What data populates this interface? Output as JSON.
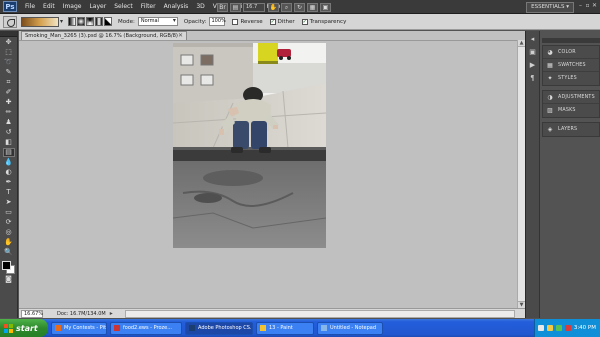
{
  "app": {
    "logo": "Ps",
    "menu": [
      "File",
      "Edit",
      "Image",
      "Layer",
      "Select",
      "Filter",
      "Analysis",
      "3D",
      "View",
      "Window",
      "Help"
    ],
    "zoom_value": "16.7",
    "workspace": "ESSENTIALS",
    "workspace_arrow": "▾",
    "window_controls": [
      "–",
      "▫",
      "✕"
    ]
  },
  "options": {
    "mode_label": "Mode:",
    "mode_value": "Normal",
    "opacity_label": "Opacity:",
    "opacity_value": "100%",
    "reverse_label": "Reverse",
    "reverse_checked": false,
    "dither_label": "Dither",
    "dither_checked": true,
    "transparency_label": "Transparency",
    "transparency_checked": true,
    "check_mark": "✓"
  },
  "document": {
    "tab_title": "Smoking_Man_3265 (3).psd @ 16.7% (Background, RGB/8)",
    "tab_close": "✕",
    "zoom_field": "16.67%",
    "doc_info": "Doc: 16.7M/134.0M",
    "status_arrow": "▸"
  },
  "tools": [
    {
      "name": "move-tool-icon",
      "glyph": "✥"
    },
    {
      "name": "marquee-tool-icon",
      "glyph": "⬚"
    },
    {
      "name": "lasso-tool-icon",
      "glyph": "➰"
    },
    {
      "name": "quick-select-tool-icon",
      "glyph": "✎"
    },
    {
      "name": "crop-tool-icon",
      "glyph": "⌗"
    },
    {
      "name": "eyedropper-tool-icon",
      "glyph": "✐"
    },
    {
      "name": "healing-brush-tool-icon",
      "glyph": "✚"
    },
    {
      "name": "brush-tool-icon",
      "glyph": "✏"
    },
    {
      "name": "clone-stamp-tool-icon",
      "glyph": "♟"
    },
    {
      "name": "history-brush-tool-icon",
      "glyph": "↺"
    },
    {
      "name": "eraser-tool-icon",
      "glyph": "◧"
    },
    {
      "name": "gradient-tool-icon",
      "glyph": "▤",
      "active": true
    },
    {
      "name": "blur-tool-icon",
      "glyph": "💧"
    },
    {
      "name": "dodge-tool-icon",
      "glyph": "◐"
    },
    {
      "name": "pen-tool-icon",
      "glyph": "✒"
    },
    {
      "name": "type-tool-icon",
      "glyph": "T"
    },
    {
      "name": "path-selection-tool-icon",
      "glyph": "➤"
    },
    {
      "name": "shape-tool-icon",
      "glyph": "▭"
    },
    {
      "name": "3d-rotate-tool-icon",
      "glyph": "⟳"
    },
    {
      "name": "3d-orbit-tool-icon",
      "glyph": "◎"
    },
    {
      "name": "hand-tool-icon",
      "glyph": "✋"
    },
    {
      "name": "zoom-tool-icon",
      "glyph": "🔍"
    }
  ],
  "dock": {
    "strip": [
      {
        "name": "dock-collapse-icon",
        "glyph": "◂"
      },
      {
        "name": "history-panel-icon",
        "glyph": "▣"
      },
      {
        "name": "actions-panel-icon",
        "glyph": "▶"
      },
      {
        "name": "paragraph-panel-icon",
        "glyph": "¶"
      }
    ],
    "groups": [
      [
        {
          "label": "COLOR",
          "icon": "color-panel-icon",
          "glyph": "◕"
        },
        {
          "label": "SWATCHES",
          "icon": "swatches-panel-icon",
          "glyph": "▦"
        },
        {
          "label": "STYLES",
          "icon": "styles-panel-icon",
          "glyph": "✦"
        }
      ],
      [
        {
          "label": "ADJUSTMENTS",
          "icon": "adjustments-panel-icon",
          "glyph": "◑"
        },
        {
          "label": "MASKS",
          "icon": "masks-panel-icon",
          "glyph": "▨"
        }
      ],
      [
        {
          "label": "LAYERS",
          "icon": "layers-panel-icon",
          "glyph": "◈"
        }
      ]
    ]
  },
  "taskbar": {
    "start_label": "start",
    "items": [
      {
        "label": "My Contests - Pit.Ey...",
        "icon_color": "#e86b1c"
      },
      {
        "label": "food2.ews - Proze...",
        "icon_color": "#cc3333"
      },
      {
        "label": "Adobe Photoshop CS...",
        "icon_color": "#1b3e70",
        "active": true
      },
      {
        "label": "13 - Paint",
        "icon_color": "#f2c230"
      },
      {
        "label": "Untitled - Notepad",
        "icon_color": "#87b7ea"
      }
    ],
    "tray_colors": [
      "#e7e7e7",
      "#f4c842",
      "#58c152",
      "#d93b3b"
    ],
    "clock": "3:40 PM"
  }
}
